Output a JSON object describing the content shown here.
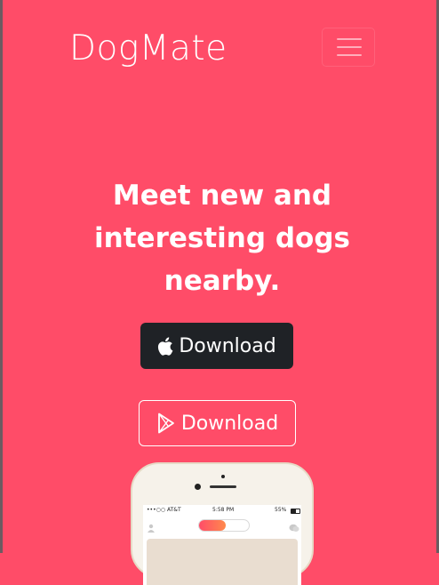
{
  "navbar": {
    "brand": "DogMate"
  },
  "hero": {
    "headline": "Meet new and interesting dogs nearby.",
    "apple_button_label": "Download",
    "play_button_label": "Download"
  },
  "phone_status": {
    "carrier": "•••○○ AT&T",
    "time": "5:58 PM",
    "battery": "55%"
  },
  "colors": {
    "background": "#ff4c68",
    "dark_button": "#1f2226",
    "text": "#ffffff"
  },
  "icons": [
    "hamburger-menu-icon",
    "apple-icon",
    "google-play-icon"
  ]
}
